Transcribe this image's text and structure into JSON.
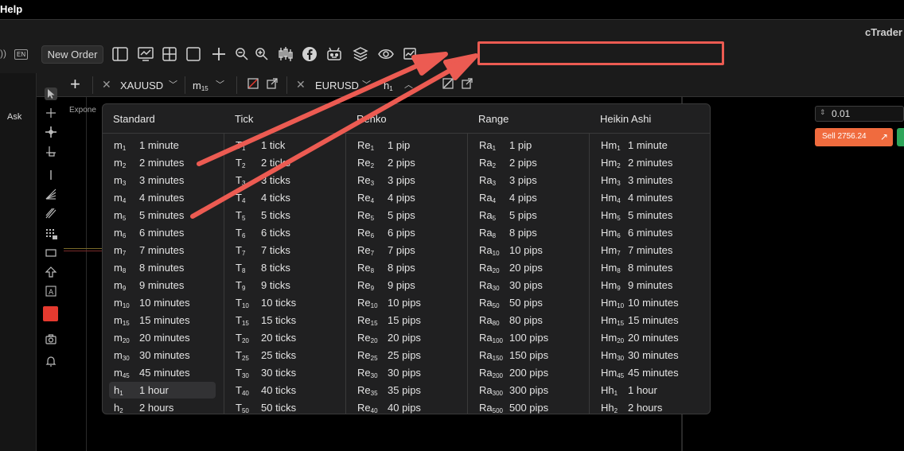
{
  "menubar": {
    "help": "Help"
  },
  "appbar": {
    "brand": "cTrader",
    "lang": "EN",
    "new_order": "New Order"
  },
  "sidebar": {
    "ask": "Ask"
  },
  "tabs": {
    "symbol1": "XAUUSD",
    "tf1": "m",
    "tf1_sub": "15",
    "symbol2": "EURUSD",
    "tf2": "h",
    "tf2_sub": "1"
  },
  "chart": {
    "indicator_label": "Expone"
  },
  "trade_panel": {
    "quantity": "0.01",
    "sell_label": "Sell 2756.24"
  },
  "colors": {
    "accent_red": "#ec5b52",
    "sell_orange": "#f06b3e",
    "buy_green": "#2ea65a"
  },
  "timeframes": {
    "headers": [
      "Standard",
      "Tick",
      "Renko",
      "Range",
      "Heikin Ashi"
    ],
    "standard": [
      {
        "p": "m",
        "s": "1",
        "l": "1 minute"
      },
      {
        "p": "m",
        "s": "2",
        "l": "2 minutes"
      },
      {
        "p": "m",
        "s": "3",
        "l": "3 minutes"
      },
      {
        "p": "m",
        "s": "4",
        "l": "4 minutes"
      },
      {
        "p": "m",
        "s": "5",
        "l": "5 minutes"
      },
      {
        "p": "m",
        "s": "6",
        "l": "6 minutes"
      },
      {
        "p": "m",
        "s": "7",
        "l": "7 minutes"
      },
      {
        "p": "m",
        "s": "8",
        "l": "8 minutes"
      },
      {
        "p": "m",
        "s": "9",
        "l": "9 minutes"
      },
      {
        "p": "m",
        "s": "10",
        "l": "10 minutes"
      },
      {
        "p": "m",
        "s": "15",
        "l": "15 minutes"
      },
      {
        "p": "m",
        "s": "20",
        "l": "20 minutes"
      },
      {
        "p": "m",
        "s": "30",
        "l": "30 minutes"
      },
      {
        "p": "m",
        "s": "45",
        "l": "45 minutes"
      },
      {
        "p": "h",
        "s": "1",
        "l": "1 hour",
        "selected": true
      },
      {
        "p": "h",
        "s": "2",
        "l": "2 hours"
      }
    ],
    "tick": [
      {
        "p": "T",
        "s": "1",
        "l": "1 tick"
      },
      {
        "p": "T",
        "s": "2",
        "l": "2 ticks"
      },
      {
        "p": "T",
        "s": "3",
        "l": "3 ticks"
      },
      {
        "p": "T",
        "s": "4",
        "l": "4 ticks"
      },
      {
        "p": "T",
        "s": "5",
        "l": "5 ticks"
      },
      {
        "p": "T",
        "s": "6",
        "l": "6 ticks"
      },
      {
        "p": "T",
        "s": "7",
        "l": "7 ticks"
      },
      {
        "p": "T",
        "s": "8",
        "l": "8 ticks"
      },
      {
        "p": "T",
        "s": "9",
        "l": "9 ticks"
      },
      {
        "p": "T",
        "s": "10",
        "l": "10 ticks"
      },
      {
        "p": "T",
        "s": "15",
        "l": "15 ticks"
      },
      {
        "p": "T",
        "s": "20",
        "l": "20 ticks"
      },
      {
        "p": "T",
        "s": "25",
        "l": "25 ticks"
      },
      {
        "p": "T",
        "s": "30",
        "l": "30 ticks"
      },
      {
        "p": "T",
        "s": "40",
        "l": "40 ticks"
      },
      {
        "p": "T",
        "s": "50",
        "l": "50 ticks"
      }
    ],
    "renko": [
      {
        "p": "Re",
        "s": "1",
        "l": "1 pip"
      },
      {
        "p": "Re",
        "s": "2",
        "l": "2 pips"
      },
      {
        "p": "Re",
        "s": "3",
        "l": "3 pips"
      },
      {
        "p": "Re",
        "s": "4",
        "l": "4 pips"
      },
      {
        "p": "Re",
        "s": "5",
        "l": "5 pips"
      },
      {
        "p": "Re",
        "s": "6",
        "l": "6 pips"
      },
      {
        "p": "Re",
        "s": "7",
        "l": "7 pips"
      },
      {
        "p": "Re",
        "s": "8",
        "l": "8 pips"
      },
      {
        "p": "Re",
        "s": "9",
        "l": "9 pips"
      },
      {
        "p": "Re",
        "s": "10",
        "l": "10 pips"
      },
      {
        "p": "Re",
        "s": "15",
        "l": "15 pips"
      },
      {
        "p": "Re",
        "s": "20",
        "l": "20 pips"
      },
      {
        "p": "Re",
        "s": "25",
        "l": "25 pips"
      },
      {
        "p": "Re",
        "s": "30",
        "l": "30 pips"
      },
      {
        "p": "Re",
        "s": "35",
        "l": "35 pips"
      },
      {
        "p": "Re",
        "s": "40",
        "l": "40 pips"
      }
    ],
    "range": [
      {
        "p": "Ra",
        "s": "1",
        "l": "1 pip"
      },
      {
        "p": "Ra",
        "s": "2",
        "l": "2 pips"
      },
      {
        "p": "Ra",
        "s": "3",
        "l": "3 pips"
      },
      {
        "p": "Ra",
        "s": "4",
        "l": "4 pips"
      },
      {
        "p": "Ra",
        "s": "5",
        "l": "5 pips"
      },
      {
        "p": "Ra",
        "s": "8",
        "l": "8 pips"
      },
      {
        "p": "Ra",
        "s": "10",
        "l": "10 pips"
      },
      {
        "p": "Ra",
        "s": "20",
        "l": "20 pips"
      },
      {
        "p": "Ra",
        "s": "30",
        "l": "30 pips"
      },
      {
        "p": "Ra",
        "s": "50",
        "l": "50 pips"
      },
      {
        "p": "Ra",
        "s": "80",
        "l": "80 pips"
      },
      {
        "p": "Ra",
        "s": "100",
        "l": "100 pips"
      },
      {
        "p": "Ra",
        "s": "150",
        "l": "150 pips"
      },
      {
        "p": "Ra",
        "s": "200",
        "l": "200 pips"
      },
      {
        "p": "Ra",
        "s": "300",
        "l": "300 pips"
      },
      {
        "p": "Ra",
        "s": "500",
        "l": "500 pips"
      }
    ],
    "heikin": [
      {
        "p": "Hm",
        "s": "1",
        "l": "1 minute"
      },
      {
        "p": "Hm",
        "s": "2",
        "l": "2 minutes"
      },
      {
        "p": "Hm",
        "s": "3",
        "l": "3 minutes"
      },
      {
        "p": "Hm",
        "s": "4",
        "l": "4 minutes"
      },
      {
        "p": "Hm",
        "s": "5",
        "l": "5 minutes"
      },
      {
        "p": "Hm",
        "s": "6",
        "l": "6 minutes"
      },
      {
        "p": "Hm",
        "s": "7",
        "l": "7 minutes"
      },
      {
        "p": "Hm",
        "s": "8",
        "l": "8 minutes"
      },
      {
        "p": "Hm",
        "s": "9",
        "l": "9 minutes"
      },
      {
        "p": "Hm",
        "s": "10",
        "l": "10 minutes"
      },
      {
        "p": "Hm",
        "s": "15",
        "l": "15 minutes"
      },
      {
        "p": "Hm",
        "s": "20",
        "l": "20 minutes"
      },
      {
        "p": "Hm",
        "s": "30",
        "l": "30 minutes"
      },
      {
        "p": "Hm",
        "s": "45",
        "l": "45 minutes"
      },
      {
        "p": "Hh",
        "s": "1",
        "l": "1 hour"
      },
      {
        "p": "Hh",
        "s": "2",
        "l": "2 hours"
      }
    ]
  }
}
